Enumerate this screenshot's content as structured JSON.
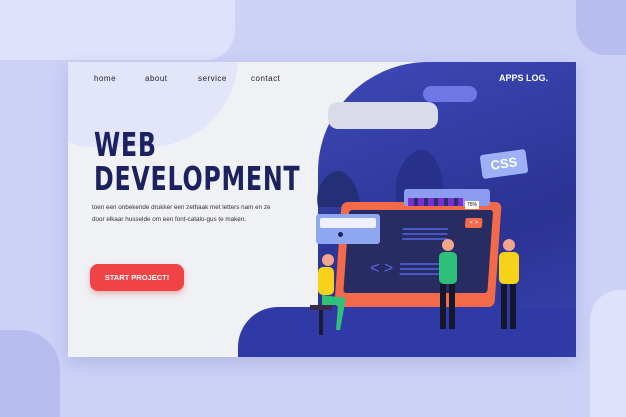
{
  "nav": {
    "items": [
      "home",
      "about",
      "service",
      "contact"
    ],
    "logo": "APPS LOG."
  },
  "hero": {
    "title_line1": "WEB",
    "title_line2": "DEVELOPMENT",
    "description": "toen een onbekende drukker een zethaak met letters nam en ze door elkaar husselde om een font-catalo-gus te maken.",
    "cta": "START PROJECT!"
  },
  "illustration": {
    "badge": "CSS",
    "progress_label": "75%",
    "progress": 0.75,
    "code_icon": "< >"
  },
  "colors": {
    "accent": "#ef4346",
    "navy": "#1c2160",
    "blue": "#2a3392"
  }
}
